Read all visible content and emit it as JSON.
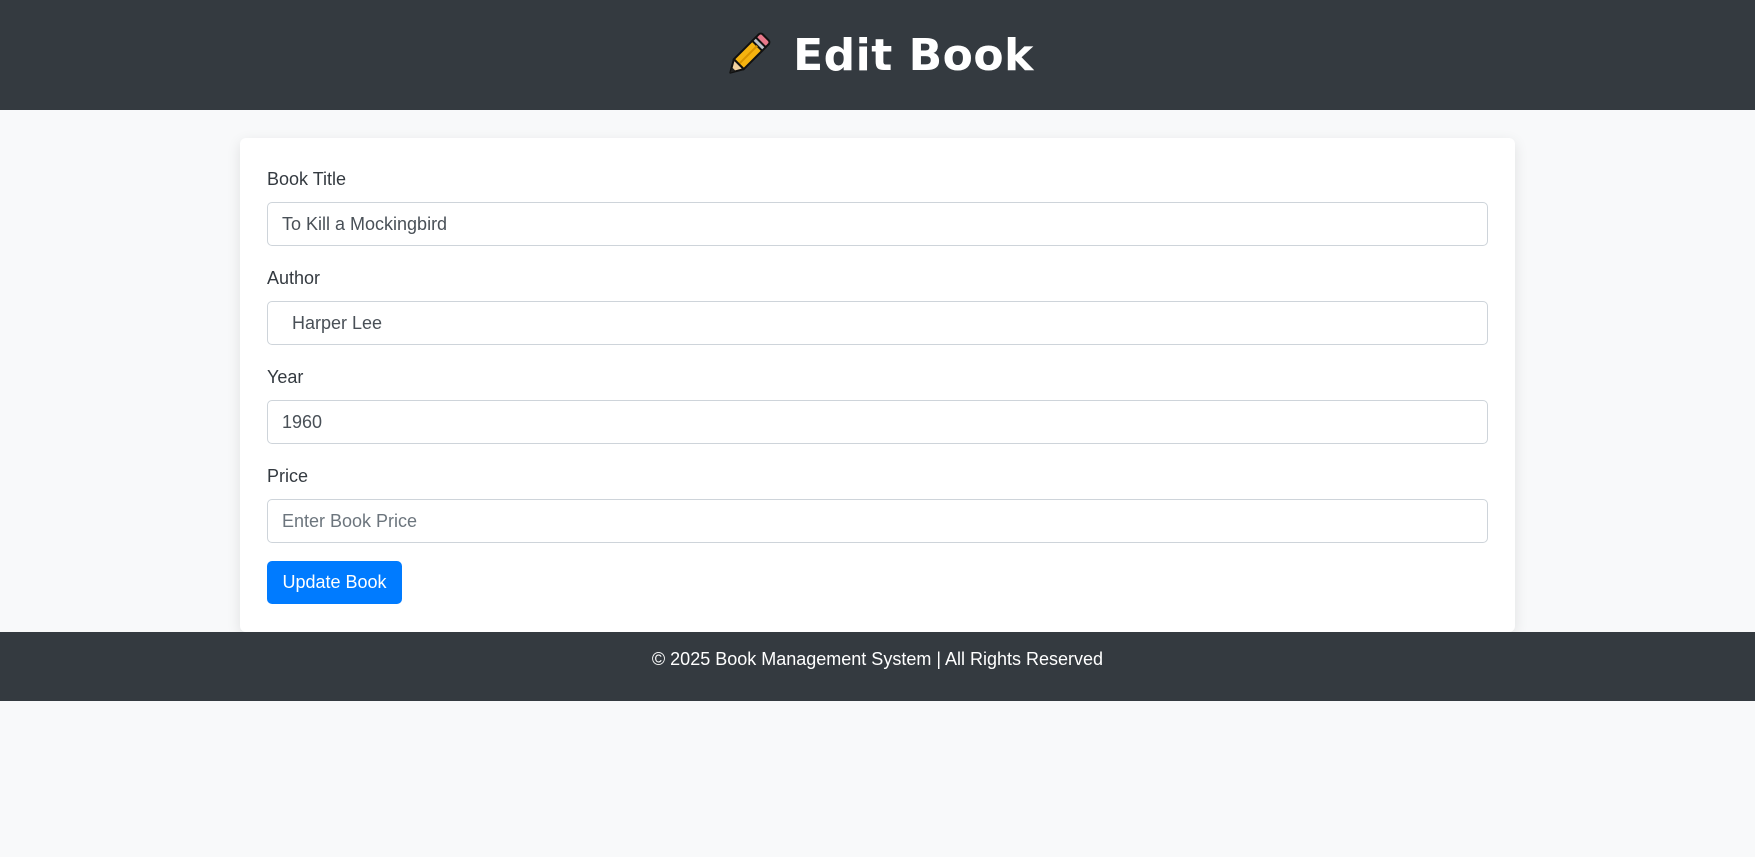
{
  "header": {
    "icon": "pencil-icon",
    "title": "Edit Book"
  },
  "form": {
    "title_label": "Book Title",
    "title_value": "To Kill a Mockingbird",
    "author_label": "Author",
    "author_value": "  Harper Lee",
    "year_label": "Year",
    "year_value": "1960",
    "price_label": "Price",
    "price_value": "",
    "price_placeholder": "Enter Book Price",
    "submit_label": "Update Book"
  },
  "footer": {
    "text": "© 2025 Book Management System | All Rights Reserved"
  },
  "colors": {
    "header_bg": "#343a40",
    "page_bg": "#f8f9fa",
    "primary": "#007bff"
  }
}
